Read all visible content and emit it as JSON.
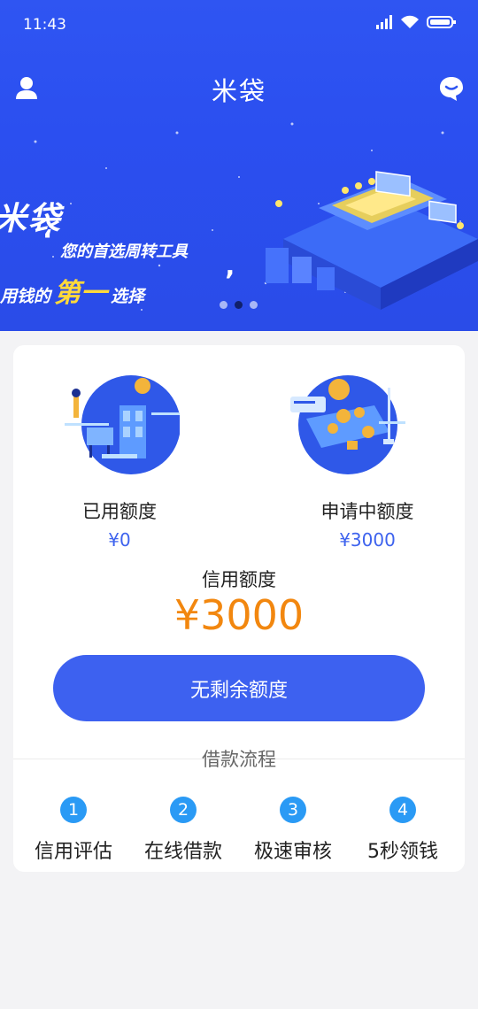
{
  "status_bar": {
    "time": "11:43"
  },
  "header": {
    "title": "米袋",
    "user_icon": "user-icon",
    "message_icon": "message-icon"
  },
  "banner": {
    "brand": "米袋",
    "line1": "您的首选周转工具",
    "line2_prefix": "用钱的",
    "line2_highlight": "第一",
    "line2_suffix": "选择",
    "slides": 3,
    "active_slide": 2
  },
  "credit_card": {
    "used": {
      "label": "已用额度",
      "value": "¥0"
    },
    "applying": {
      "label": "申请中额度",
      "value": "¥3000"
    },
    "credit": {
      "label": "信用额度",
      "value": "¥3000"
    },
    "button_label": "无剩余额度"
  },
  "process": {
    "title": "借款流程",
    "steps": [
      {
        "num": "1",
        "label": "信用评估"
      },
      {
        "num": "2",
        "label": "在线借款"
      },
      {
        "num": "3",
        "label": "极速审核"
      },
      {
        "num": "4",
        "label": "5秒领钱"
      }
    ]
  },
  "colors": {
    "primary": "#3d61f0",
    "accent": "#f2870f",
    "step": "#2a9af5",
    "banner": "#2b4ff0"
  }
}
